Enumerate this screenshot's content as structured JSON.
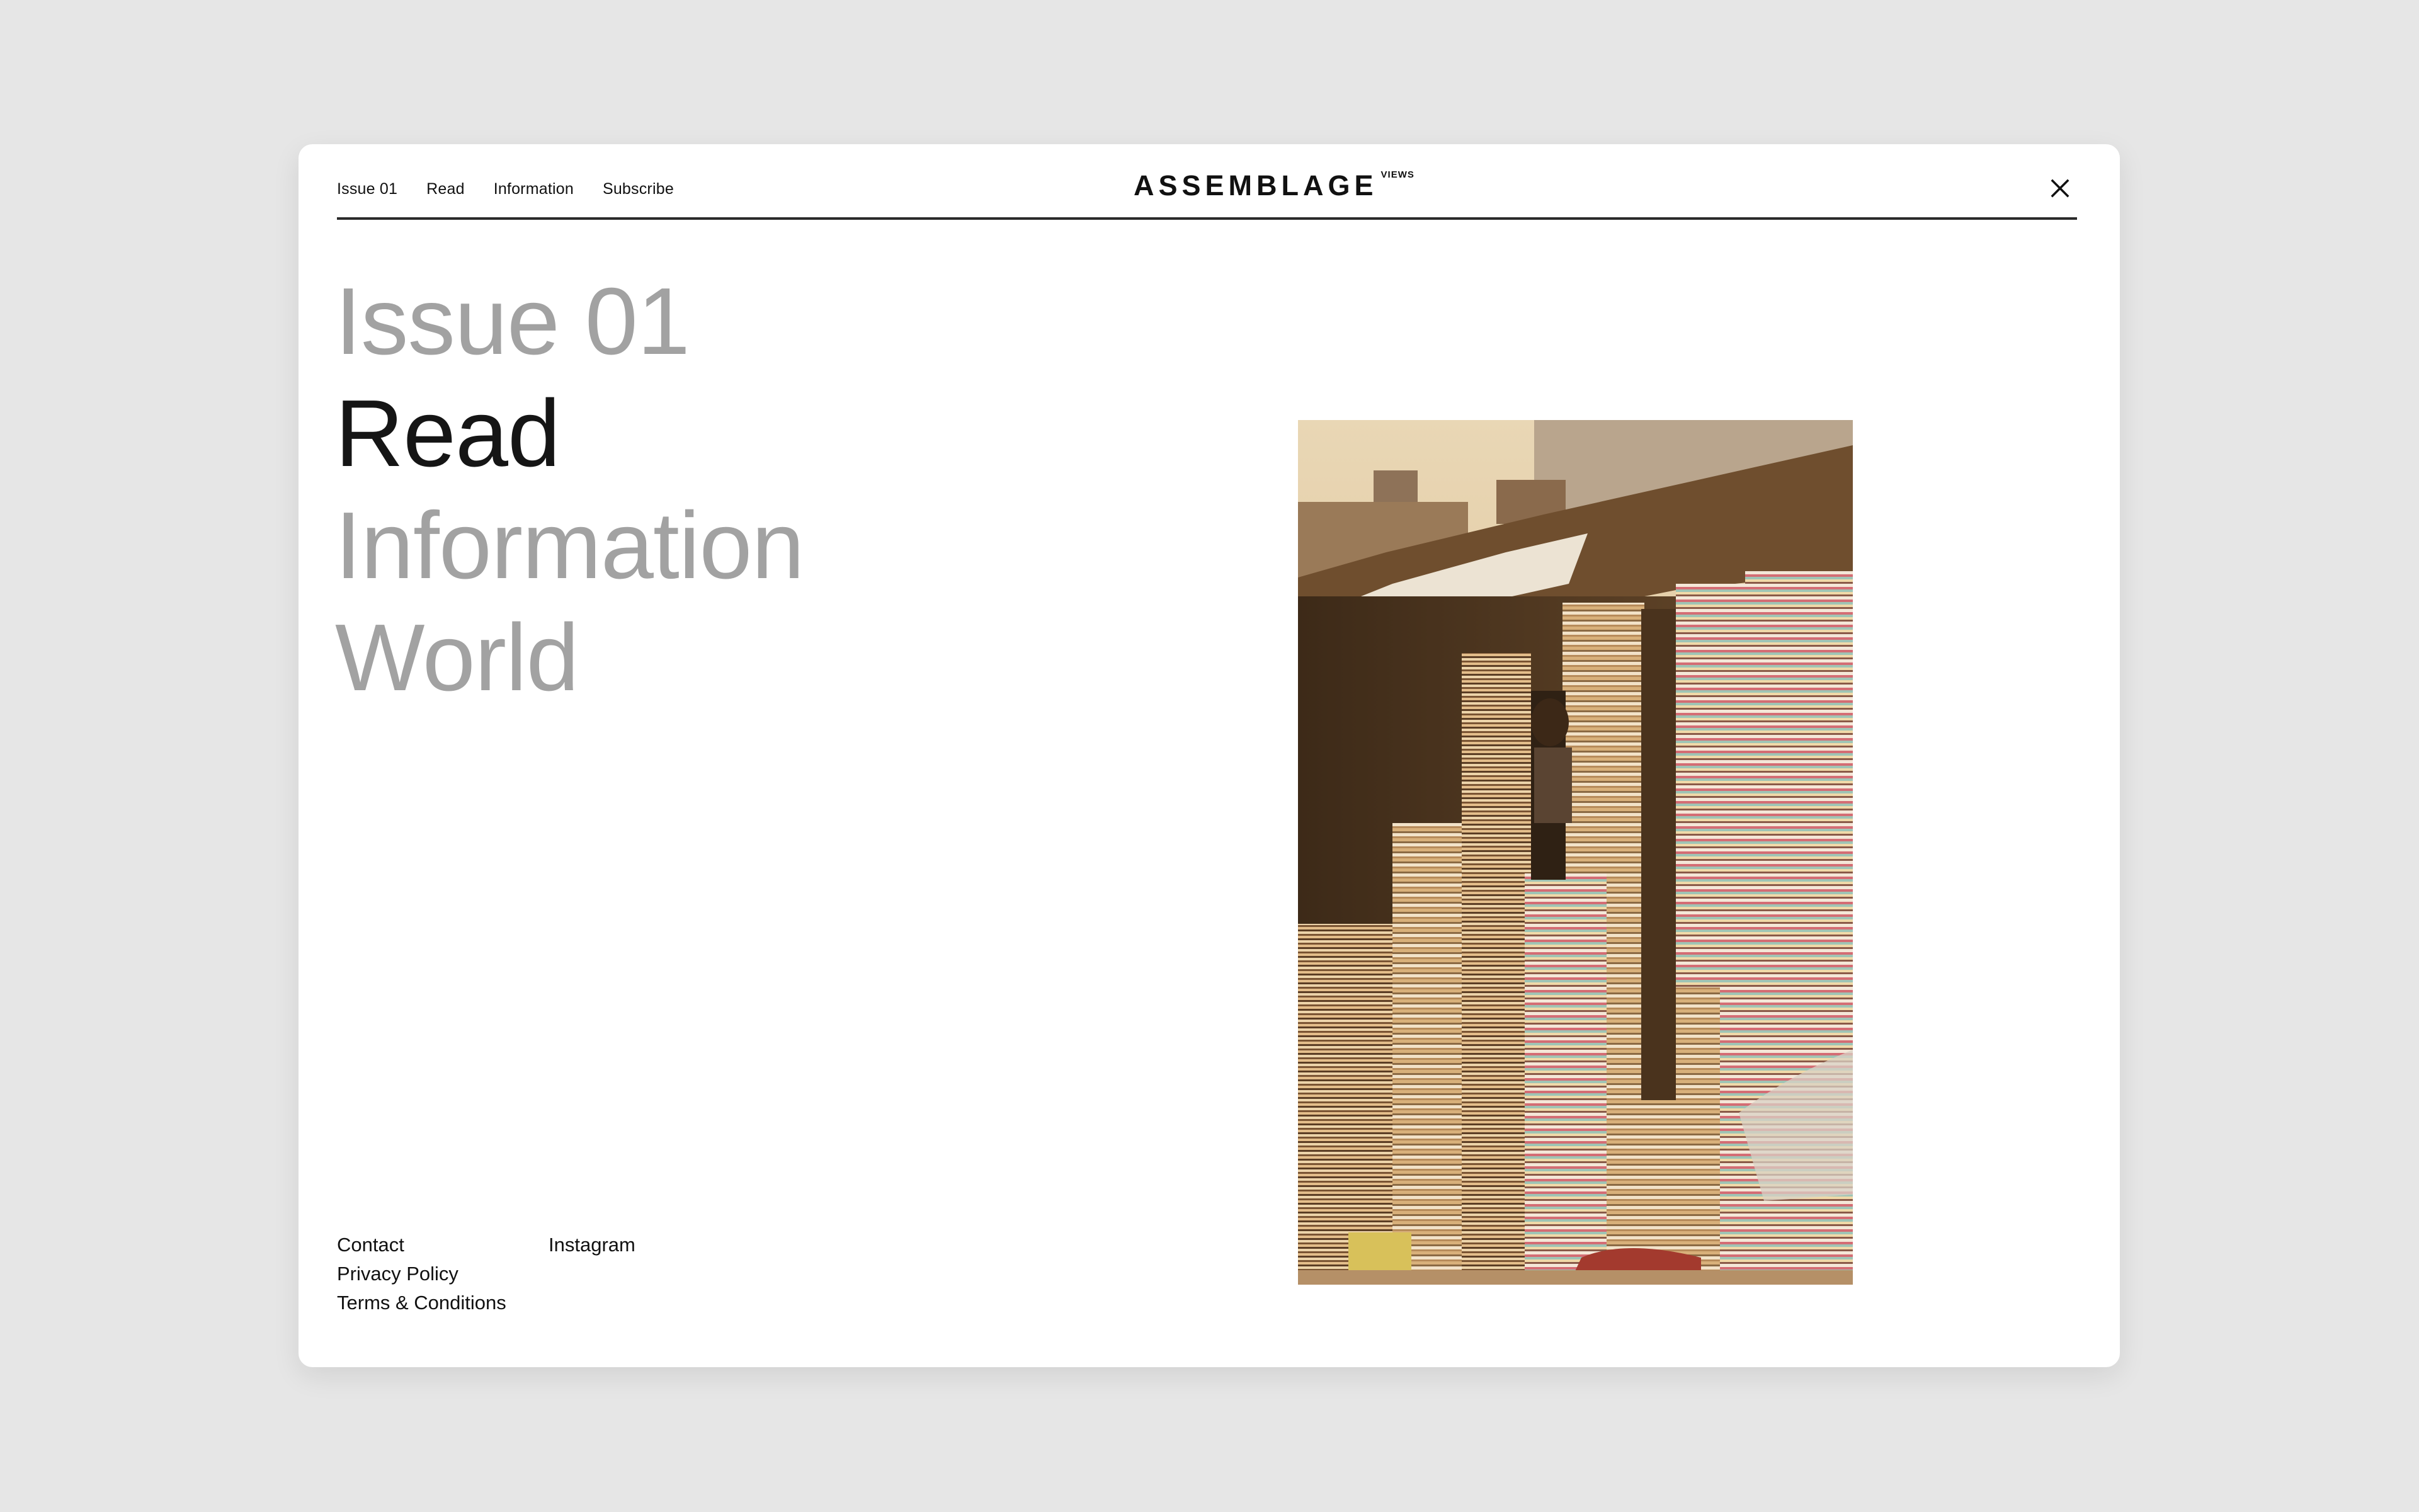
{
  "nav": {
    "links": [
      "Issue 01",
      "Read",
      "Information",
      "Subscribe"
    ]
  },
  "brand": {
    "name": "ASSEMBLAGE",
    "superscript": "VIEWS"
  },
  "close_icon": "close-icon",
  "menu": {
    "items": [
      "Issue 01",
      "Read",
      "Information",
      "World"
    ],
    "active_index": 1
  },
  "footer": {
    "col1": [
      "Contact",
      "Privacy Policy",
      "Terms & Conditions"
    ],
    "col2": [
      "Instagram"
    ]
  },
  "colors": {
    "background": "#e6e6e6",
    "card": "#ffffff",
    "text": "#111111",
    "menu_inactive": "#a2a2a2",
    "menu_active": "#151515"
  }
}
